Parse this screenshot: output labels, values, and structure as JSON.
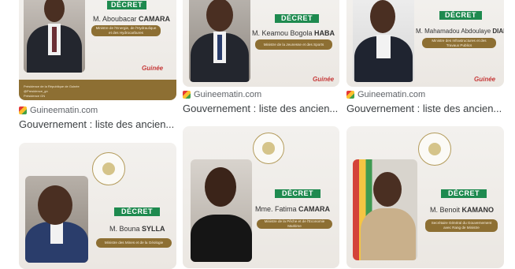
{
  "results": [
    {
      "source": "Guineematin.com",
      "title": "Gouvernement : liste des ancien...",
      "badge": "DÉCRET",
      "name_first": "M. Aboubacar ",
      "name_last": "CAMARA",
      "ministry": "Ministre de l'Energie, de l'Hydraulique et des Hydrocarbures",
      "brand": "Guinée",
      "footer_lines": [
        "Présidence de la République de Guinée",
        "@Presidence_gn",
        "Présidence GN"
      ]
    },
    {
      "source": "Guineematin.com",
      "title": "Gouvernement : liste des ancien...",
      "badge": "DÉCRET",
      "name_first": "M. Keamou Bogola ",
      "name_last": "HABA",
      "ministry": "Ministre de la Jeunesse et des Sports",
      "brand": "Guinée"
    },
    {
      "source": "Guineematin.com",
      "title": "Gouvernement : liste des ancien...",
      "badge": "DÉCRET",
      "name_first": "M. Mahamadou Abdoulaye ",
      "name_last": "DIALLO",
      "ministry": "Ministre des Infrastructures et des Travaux Publics",
      "brand": "Guinée"
    },
    {
      "badge": "DÉCRET",
      "name_first": "M. Bouna ",
      "name_last": "SYLLA",
      "ministry": "Ministre des Mines et de la Géologie"
    },
    {
      "badge": "DÉCRET",
      "name_first": "Mme. Fatima ",
      "name_last": "CAMARA",
      "ministry": "Ministre de la Pêche et de l'Economie Maritime"
    },
    {
      "badge": "DÉCRET",
      "name_first": "M. Benoit ",
      "name_last": "KAMANO",
      "ministry": "Secrétaire Général du Gouvernement avec Rang de Ministre"
    }
  ]
}
